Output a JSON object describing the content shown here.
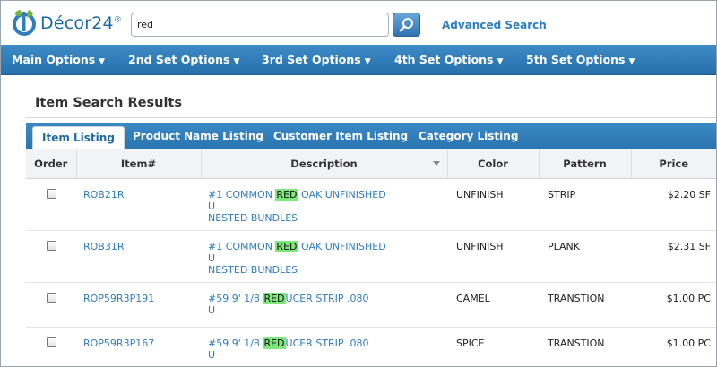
{
  "brand": {
    "name": "Décor24",
    "reg": "®"
  },
  "search": {
    "value": "red",
    "placeholder": ""
  },
  "advanced_search": "Advanced Search",
  "nav": [
    {
      "label": "Main Options"
    },
    {
      "label": "2nd Set Options"
    },
    {
      "label": "3rd Set Options"
    },
    {
      "label": "4th Set Options"
    },
    {
      "label": "5th Set Options"
    }
  ],
  "nav_caret": "▼",
  "results": {
    "title": "Item Search Results",
    "tabs": [
      {
        "label": "Item Listing",
        "active": true
      },
      {
        "label": "Product Name Listing",
        "active": false
      },
      {
        "label": "Customer Item Listing",
        "active": false
      },
      {
        "label": "Category Listing",
        "active": false
      }
    ],
    "columns": [
      "Order",
      "Item#",
      "Description",
      "Color",
      "Pattern",
      "Price"
    ],
    "rows": [
      {
        "item": "ROB21R",
        "desc_pre": "#1 COMMON ",
        "desc_hl": "RED",
        "desc_post": " OAK UNFINISHED",
        "desc_line2": "U",
        "desc_line3": "NESTED BUNDLES",
        "color": "UNFINISH",
        "pattern": "STRIP",
        "price": "$2.20 SF"
      },
      {
        "item": "ROB31R",
        "desc_pre": "#1 COMMON ",
        "desc_hl": "RED",
        "desc_post": " OAK UNFINISHED",
        "desc_line2": "U",
        "desc_line3": "NESTED BUNDLES",
        "color": "UNFINISH",
        "pattern": "PLANK",
        "price": "$2.31 SF"
      },
      {
        "item": "ROP59R3P191",
        "desc_pre": "#59 9' 1/8 ",
        "desc_hl": "RED",
        "desc_post": "UCER STRIP .080",
        "desc_line2": "U",
        "desc_line3": "",
        "color": "CAMEL",
        "pattern": "TRANSTION",
        "price": "$1.00 PC"
      },
      {
        "item": "ROP59R3P167",
        "desc_pre": "#59 9' 1/8 ",
        "desc_hl": "RED",
        "desc_post": "UCER STRIP .080",
        "desc_line2": "U",
        "desc_line3": "",
        "color": "SPICE",
        "pattern": "TRANSTION",
        "price": "$1.00 PC"
      }
    ]
  },
  "colors": {
    "nav_bg": "#2f7ebd",
    "link": "#2f7ebd",
    "highlight": "#7ce87c",
    "header_row": "#f2f3f5"
  }
}
